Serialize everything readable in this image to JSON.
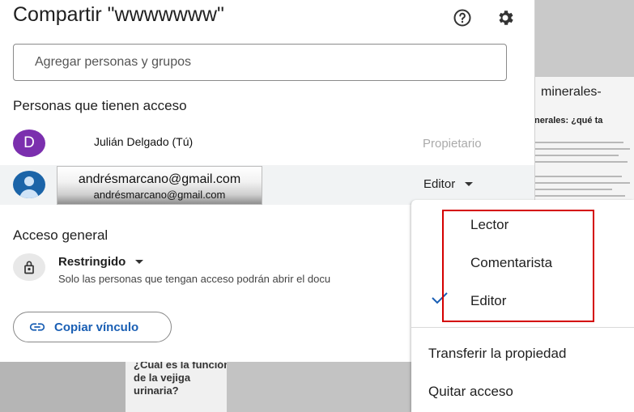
{
  "dialog": {
    "title": "Compartir \"wwwwwww\"",
    "add_people_placeholder": "Agregar personas y grupos",
    "people_section_title": "Personas que tienen acceso",
    "people": [
      {
        "avatar_letter": "D",
        "name": "Julián Delgado (Tú)",
        "role": "Propietario",
        "avatar_color": "#7b2fae"
      },
      {
        "email": "andrésmarcano@gmail.com",
        "email_secondary": "andrésmarcano@gmail.com",
        "role": "Editor",
        "avatar_color": "#1b64a8"
      }
    ],
    "general_access_title": "Acceso general",
    "access_level": "Restringido",
    "access_description": "Solo las personas que tengan acceso podrán abrir el docu",
    "copy_link_label": "Copiar vínculo"
  },
  "role_menu": {
    "options": [
      "Lector",
      "Comentarista",
      "Editor"
    ],
    "selected": "Editor",
    "transfer_label": "Transferir la propiedad",
    "remove_label": "Quitar acceso"
  },
  "background_doc": {
    "heading": "minerales-",
    "subheading": "nerales: ¿qué ta",
    "bottom_heading": "¿Cuál es la función de la vejiga urinaria?"
  },
  "colors": {
    "accent_blue": "#1a5fb4",
    "highlight_red": "#d40000"
  }
}
